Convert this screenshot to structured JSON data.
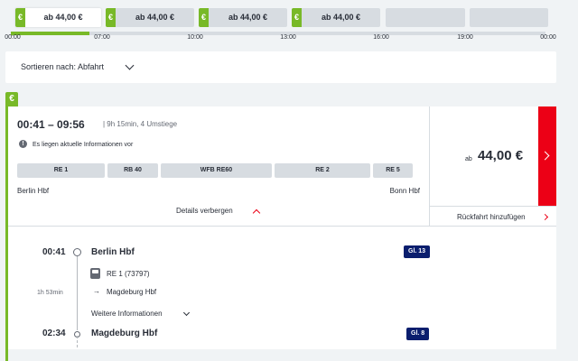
{
  "colors": {
    "accent_green": "#78b928",
    "accent_red": "#ec0016",
    "track_badge": "#0a1e6e"
  },
  "time_slots": [
    {
      "icon": "euro-icon",
      "euro_symbol": "€",
      "price": "ab 44,00 €",
      "active": true
    },
    {
      "icon": "euro-icon",
      "euro_symbol": "€",
      "price": "ab 44,00 €",
      "active": false
    },
    {
      "icon": "euro-icon",
      "euro_symbol": "€",
      "price": "ab 44,00 €",
      "active": false
    },
    {
      "icon": "euro-icon",
      "euro_symbol": "€",
      "price": "ab 44,00 €",
      "active": false
    },
    {
      "price": "",
      "active": false
    },
    {
      "price": "",
      "active": false
    }
  ],
  "timeline": {
    "ticks": [
      "00:00",
      "07:00",
      "10:00",
      "13:00",
      "16:00",
      "19:00",
      "00:00"
    ]
  },
  "sort": {
    "label": "Sortieren nach: Abfahrt"
  },
  "connection": {
    "euro_symbol": "€",
    "time_range": "00:41 – 09:56",
    "duration_changes": "| 9h 15min, 4 Umstiege",
    "info_symbol": "!",
    "info_text": "Es liegen aktuelle Informationen vor",
    "segments": [
      "RE 1",
      "RB 40",
      "WFB RE60",
      "RE 2",
      "RE 5"
    ],
    "from_station": "Berlin Hbf",
    "to_station": "Bonn Hbf",
    "details_toggle": "Details verbergen",
    "price_prefix": "ab",
    "price": "44,00 €",
    "return_label": "Rückfahrt hinzufügen"
  },
  "journey": {
    "departure_time": "00:41",
    "departure_station": "Berlin Hbf",
    "departure_track": "Gl. 13",
    "train": "RE 1 (73797)",
    "leg_duration": "1h 53min",
    "direction_arrow": "→",
    "direction": "Magdeburg Hbf",
    "more_info": "Weitere Informationen",
    "arrival_time": "02:34",
    "arrival_station": "Magdeburg Hbf",
    "arrival_track": "Gl. 8"
  }
}
